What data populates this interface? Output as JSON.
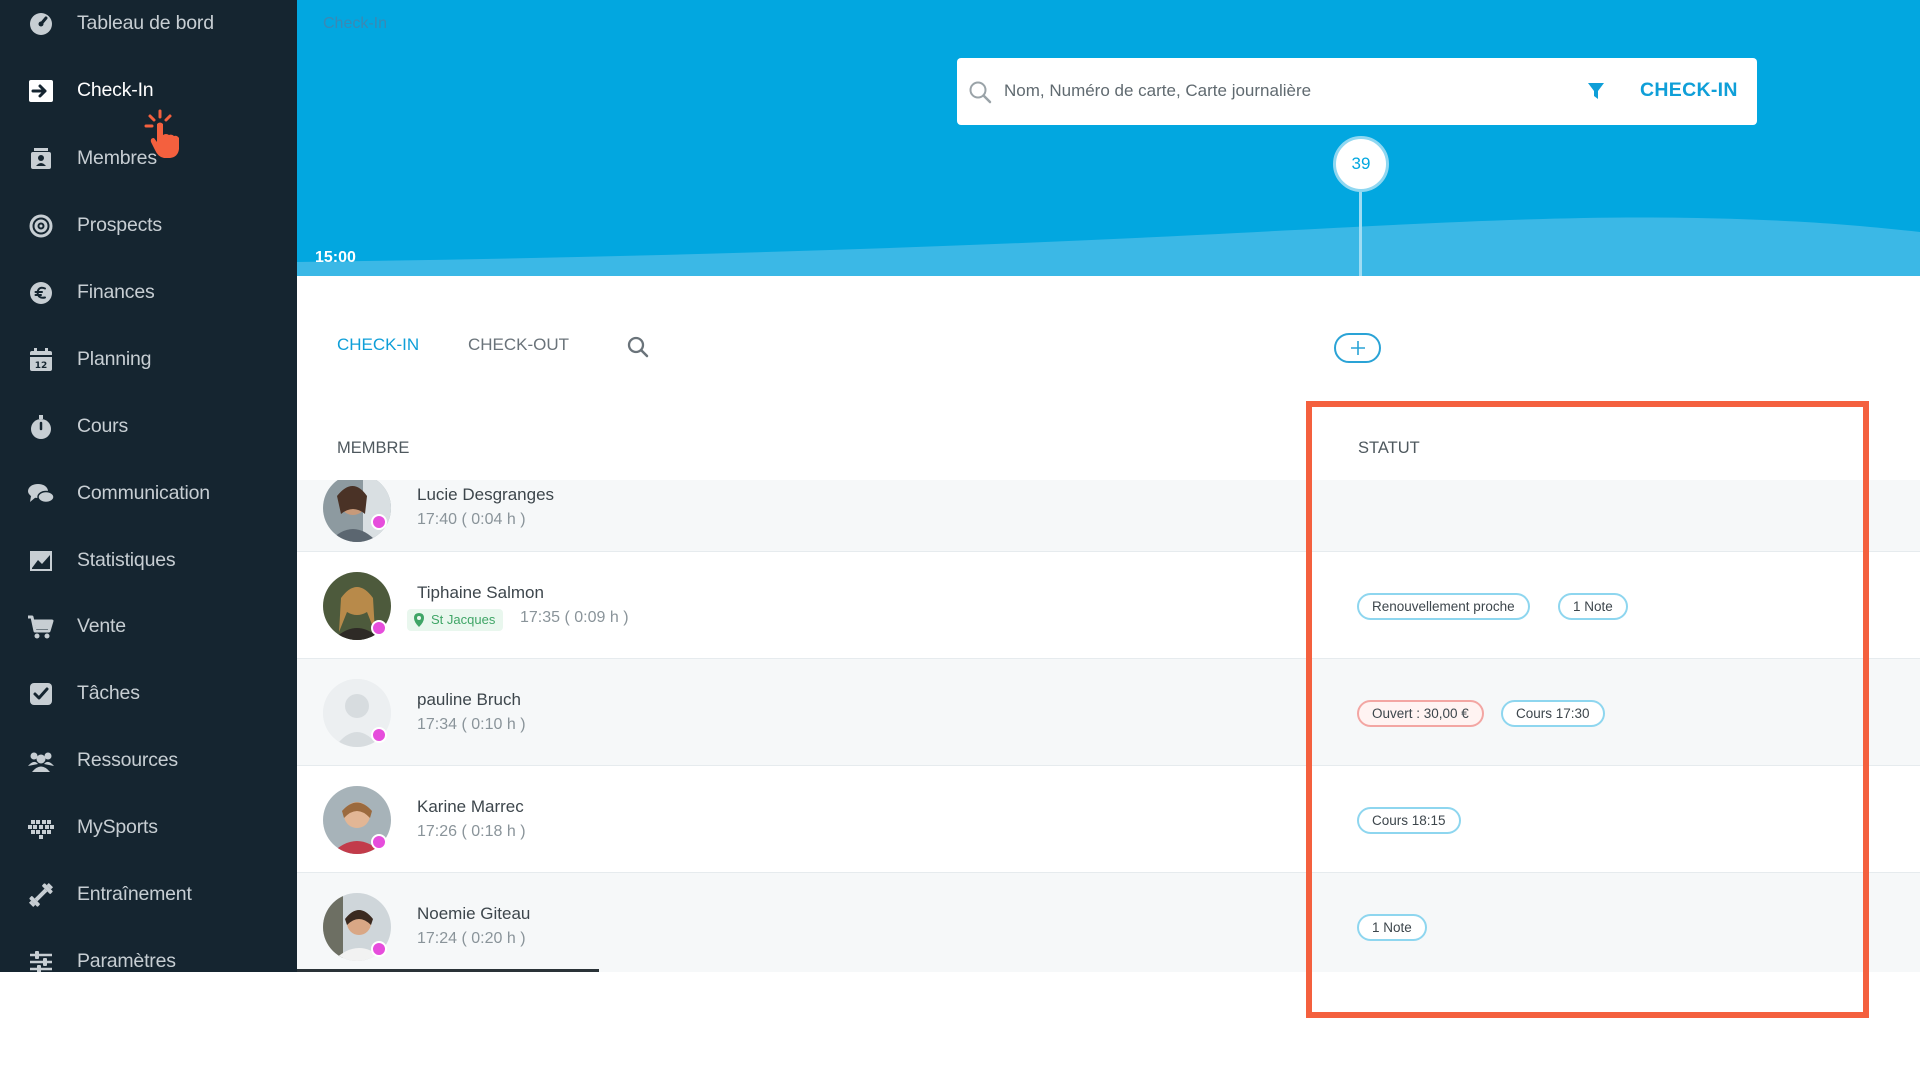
{
  "sidebar": {
    "items": [
      {
        "label": "Tableau de bord",
        "icon": "dashboard-icon"
      },
      {
        "label": "Check-In",
        "icon": "check-in-icon",
        "active": true
      },
      {
        "label": "Membres",
        "icon": "members-icon"
      },
      {
        "label": "Prospects",
        "icon": "prospects-icon"
      },
      {
        "label": "Finances",
        "icon": "euro-icon"
      },
      {
        "label": "Planning",
        "icon": "calendar-icon"
      },
      {
        "label": "Cours",
        "icon": "stopwatch-icon"
      },
      {
        "label": "Communication",
        "icon": "chat-icon"
      },
      {
        "label": "Statistiques",
        "icon": "chart-icon"
      },
      {
        "label": "Vente",
        "icon": "cart-icon"
      },
      {
        "label": "Tâches",
        "icon": "checkbox-icon"
      },
      {
        "label": "Ressources",
        "icon": "users-icon"
      },
      {
        "label": "MySports",
        "icon": "mysports-icon"
      },
      {
        "label": "Entraînement",
        "icon": "dumbbell-icon"
      },
      {
        "label": "Paramètres",
        "icon": "sliders-icon"
      }
    ]
  },
  "header": {
    "breadcrumb": "Check-In",
    "time": "15:00",
    "search_placeholder": "Nom, Numéro de carte, Carte journalière",
    "checkin_button": "CHECK-IN",
    "counter": "39"
  },
  "tabs": {
    "checkin": "CHECK-IN",
    "checkout": "CHECK-OUT"
  },
  "table": {
    "col_member": "MEMBRE",
    "col_status": "STATUT",
    "rows": [
      {
        "name": "Lucie Desgranges",
        "time": "17:40 ( 0:04 h )",
        "location": "",
        "badges": []
      },
      {
        "name": "Tiphaine Salmon",
        "time": "17:35 ( 0:09 h )",
        "location": "St Jacques",
        "badges": [
          {
            "text": "Renouvellement proche",
            "tone": "blue"
          },
          {
            "text": "1 Note",
            "tone": "blue"
          }
        ]
      },
      {
        "name": "pauline Bruch",
        "time": "17:34 ( 0:10 h )",
        "location": "",
        "badges": [
          {
            "text": "Ouvert : 30,00 €",
            "tone": "red"
          },
          {
            "text": "Cours 17:30",
            "tone": "blue"
          }
        ]
      },
      {
        "name": "Karine Marrec",
        "time": "17:26 ( 0:18 h )",
        "location": "",
        "badges": [
          {
            "text": "Cours 18:15",
            "tone": "blue"
          }
        ]
      },
      {
        "name": "Noemie Giteau",
        "time": "17:24 ( 0:20 h )",
        "location": "",
        "badges": [
          {
            "text": "1 Note",
            "tone": "blue"
          }
        ]
      }
    ]
  },
  "colors": {
    "sidebar_bg": "#152530",
    "header_bg": "#02a7e0",
    "accent": "#0f9fd8",
    "presence_dot": "#e64ddc",
    "highlight": "#f4603e"
  }
}
